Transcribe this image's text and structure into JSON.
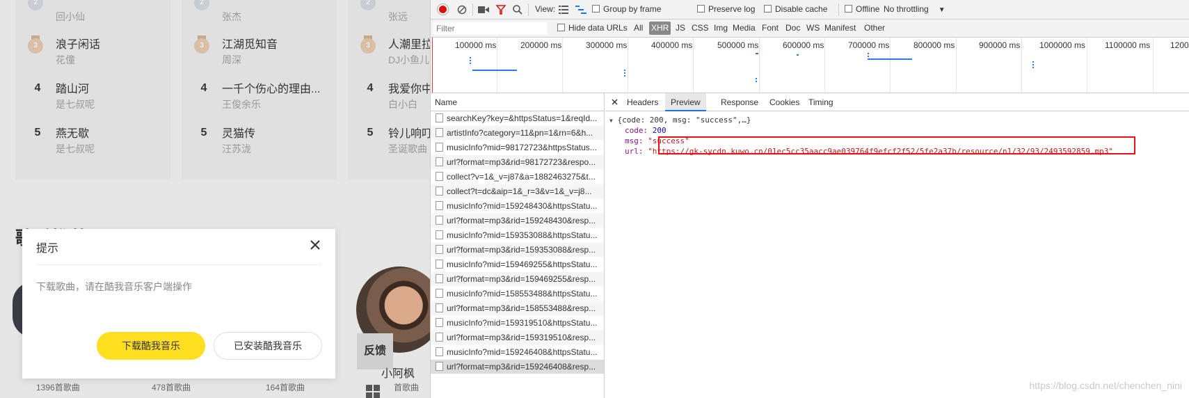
{
  "page": {
    "ranklists": [
      {
        "items": [
          {
            "rank": "2",
            "title": "",
            "artist": "回小仙"
          },
          {
            "rank": "3",
            "title": "浪子闲话",
            "artist": "花僮"
          },
          {
            "rank": "4",
            "title": "踏山河",
            "artist": "是七叔呢"
          },
          {
            "rank": "5",
            "title": "燕无歇",
            "artist": "是七叔呢"
          }
        ]
      },
      {
        "items": [
          {
            "rank": "2",
            "title": "",
            "artist": "张杰"
          },
          {
            "rank": "3",
            "title": "江湖觅知音",
            "artist": "周深"
          },
          {
            "rank": "4",
            "title": "一千个伤心的理由...",
            "artist": "王俊余乐"
          },
          {
            "rank": "5",
            "title": "灵猫传",
            "artist": "汪苏泷"
          }
        ]
      },
      {
        "items": [
          {
            "rank": "2",
            "title": "",
            "artist": "张远"
          },
          {
            "rank": "3",
            "title": "人潮里拉",
            "artist": "DJ小鱼儿"
          },
          {
            "rank": "4",
            "title": "我爱你中",
            "artist": "白小白"
          },
          {
            "rank": "5",
            "title": "铃儿响叮",
            "artist": "圣诞歌曲"
          }
        ]
      }
    ],
    "section_heading": "歌手推荐",
    "feedback_label": "反馈",
    "artist_name": "小阿枫",
    "song_counts": [
      "1396首歌曲",
      "478首歌曲",
      "164首歌曲",
      "首歌曲"
    ]
  },
  "dialog": {
    "title": "提示",
    "message": "下载歌曲，请在酷我音乐客户端操作",
    "primary_button": "下载酷我音乐",
    "secondary_button": "已安装酷我音乐",
    "accent_color": "#ffdf1f"
  },
  "devtools": {
    "toolbar": {
      "view_label": "View:",
      "group_by_frame": "Group by frame",
      "preserve_log": "Preserve log",
      "disable_cache": "Disable cache",
      "offline": "Offline",
      "throttling": "No throttling"
    },
    "filter": {
      "placeholder": "Filter",
      "hide_data_urls": "Hide data URLs",
      "types": [
        "All",
        "XHR",
        "JS",
        "CSS",
        "Img",
        "Media",
        "Font",
        "Doc",
        "WS",
        "Manifest",
        "Other"
      ],
      "active_type": "XHR"
    },
    "timeline": {
      "labels": [
        "100000 ms",
        "200000 ms",
        "300000 ms",
        "400000 ms",
        "500000 ms",
        "600000 ms",
        "700000 ms",
        "800000 ms",
        "900000 ms",
        "1000000 ms",
        "1100000 ms",
        "1200"
      ]
    },
    "requests": {
      "header": "Name",
      "rows": [
        "searchKey?key=&httpsStatus=1&reqId...",
        "artistInfo?category=11&pn=1&rn=6&h...",
        "musicInfo?mid=98172723&httpsStatus...",
        "url?format=mp3&rid=98172723&respo...",
        "collect?v=1&_v=j87&a=1882463275&t...",
        "collect?t=dc&aip=1&_r=3&v=1&_v=j8...",
        "musicInfo?mid=159248430&httpsStatu...",
        "url?format=mp3&rid=159248430&resp...",
        "musicInfo?mid=159353088&httpsStatu...",
        "url?format=mp3&rid=159353088&resp...",
        "musicInfo?mid=159469255&httpsStatu...",
        "url?format=mp3&rid=159469255&resp...",
        "musicInfo?mid=158553488&httpsStatu...",
        "url?format=mp3&rid=158553488&resp...",
        "musicInfo?mid=159319510&httpsStatu...",
        "url?format=mp3&rid=159319510&resp...",
        "musicInfo?mid=159246408&httpsStatu...",
        "url?format=mp3&rid=159246408&resp..."
      ],
      "selected_index": 17
    },
    "detail_tabs": [
      "Headers",
      "Preview",
      "Response",
      "Cookies",
      "Timing"
    ],
    "active_detail_tab": "Preview",
    "preview": {
      "summary": "{code: 200, msg: \"success\",…}",
      "code_key": "code:",
      "code_value": "200",
      "msg_key": "msg:",
      "msg_value": "\"success\"",
      "url_key": "url:",
      "url_value": "\"https://gk-sycdn.kuwo.cn/01ec5cc35aacc9ae039764f9efcf2f52/5fe2a37b/resource/n1/32/93/2493592859.mp3\""
    },
    "highlight_color": "#e81010"
  },
  "watermark": "https://blog.csdn.net/chenchen_nini"
}
